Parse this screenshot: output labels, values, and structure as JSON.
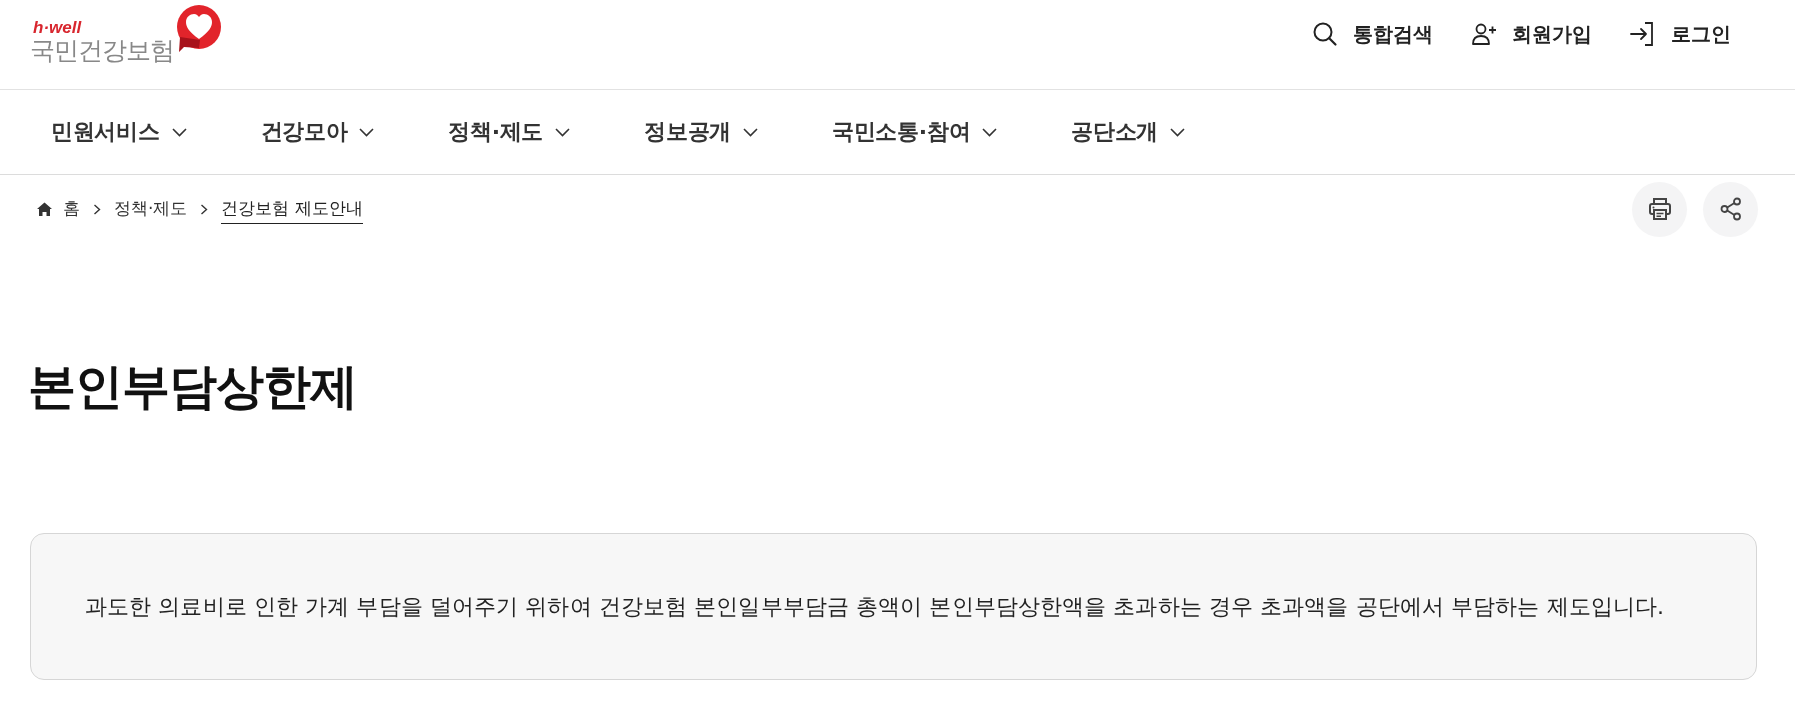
{
  "header": {
    "logo": {
      "tagline": "h·well",
      "name": "국민건강보험"
    },
    "utility_links": [
      {
        "kind": "search",
        "label": "통합검색"
      },
      {
        "kind": "signup",
        "label": "회원가입"
      },
      {
        "kind": "login",
        "label": "로그인"
      }
    ]
  },
  "nav": {
    "items": [
      "민원서비스",
      "건강모아",
      "정책·제도",
      "정보공개",
      "국민소통·참여",
      "공단소개"
    ]
  },
  "breadcrumb": [
    {
      "kind": "home",
      "label": "홈",
      "current": false
    },
    {
      "kind": "link",
      "label": "정책·제도",
      "current": false
    },
    {
      "kind": "link",
      "label": "건강보험 제도안내",
      "current": true
    }
  ],
  "title": "본인부담상한제",
  "summary_box": {
    "text": "과도한 의료비로 인한 가계 부담을 덜어주기 위하여 건강보험 본인일부부담금 총액이 본인부담상한액을 초과하는 경우 초과액을 공단에서 부담하는 제도입니다."
  }
}
